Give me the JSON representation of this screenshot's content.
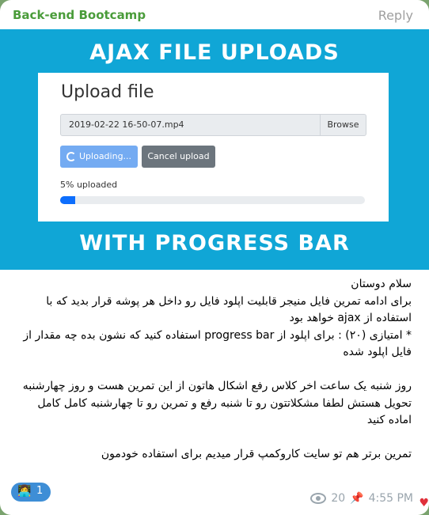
{
  "header": {
    "channel": "Back-end Bootcamp",
    "reply": "Reply"
  },
  "banner": {
    "top": "AJAX FILE UPLOADS",
    "bottom": "WITH PROGRESS BAR",
    "card": {
      "title": "Upload file",
      "file_name": "2019-02-22 16-50-07.mp4",
      "browse": "Browse",
      "uploading_btn": "Uploading...",
      "cancel_btn": "Cancel upload",
      "progress_text": "5% uploaded",
      "progress_fraction": 0.05
    }
  },
  "message": {
    "text": "سلام دوستان\nبرای ادامه تمرین فایل منیجر قابلیت اپلود فایل رو داخل هر پوشه قرار بدید که با استفاده از ajax خواهد بود\n* امتیازی (۲۰) : برای اپلود از progress bar استفاده کنید که نشون بده چه مقدار از فایل اپلود شده\n\nروز شنبه یک ساعت اخر کلاس رفع اشکال هاتون از این تمرین هست و روز چهارشنبه تحویل هستش لطفا مشکلاتتون رو تا شنبه رفع و تمرین رو تا چهارشنبه کامل کامل اماده کنید\n\nتمرین برتر هم تو سایت کاروکمپ قرار میدیم برای استفاده خودمون"
  },
  "reaction": {
    "emoji": "👩‍💻",
    "count": "1"
  },
  "footer": {
    "views": "20",
    "time": "4:55 PM"
  },
  "icons": {
    "views": "eye-icon",
    "pin": "pin-icon",
    "heart": "heart-icon"
  },
  "colors": {
    "accent": "#4a9c3a",
    "banner": "#10a6d6",
    "reaction": "#3e8ed6"
  }
}
